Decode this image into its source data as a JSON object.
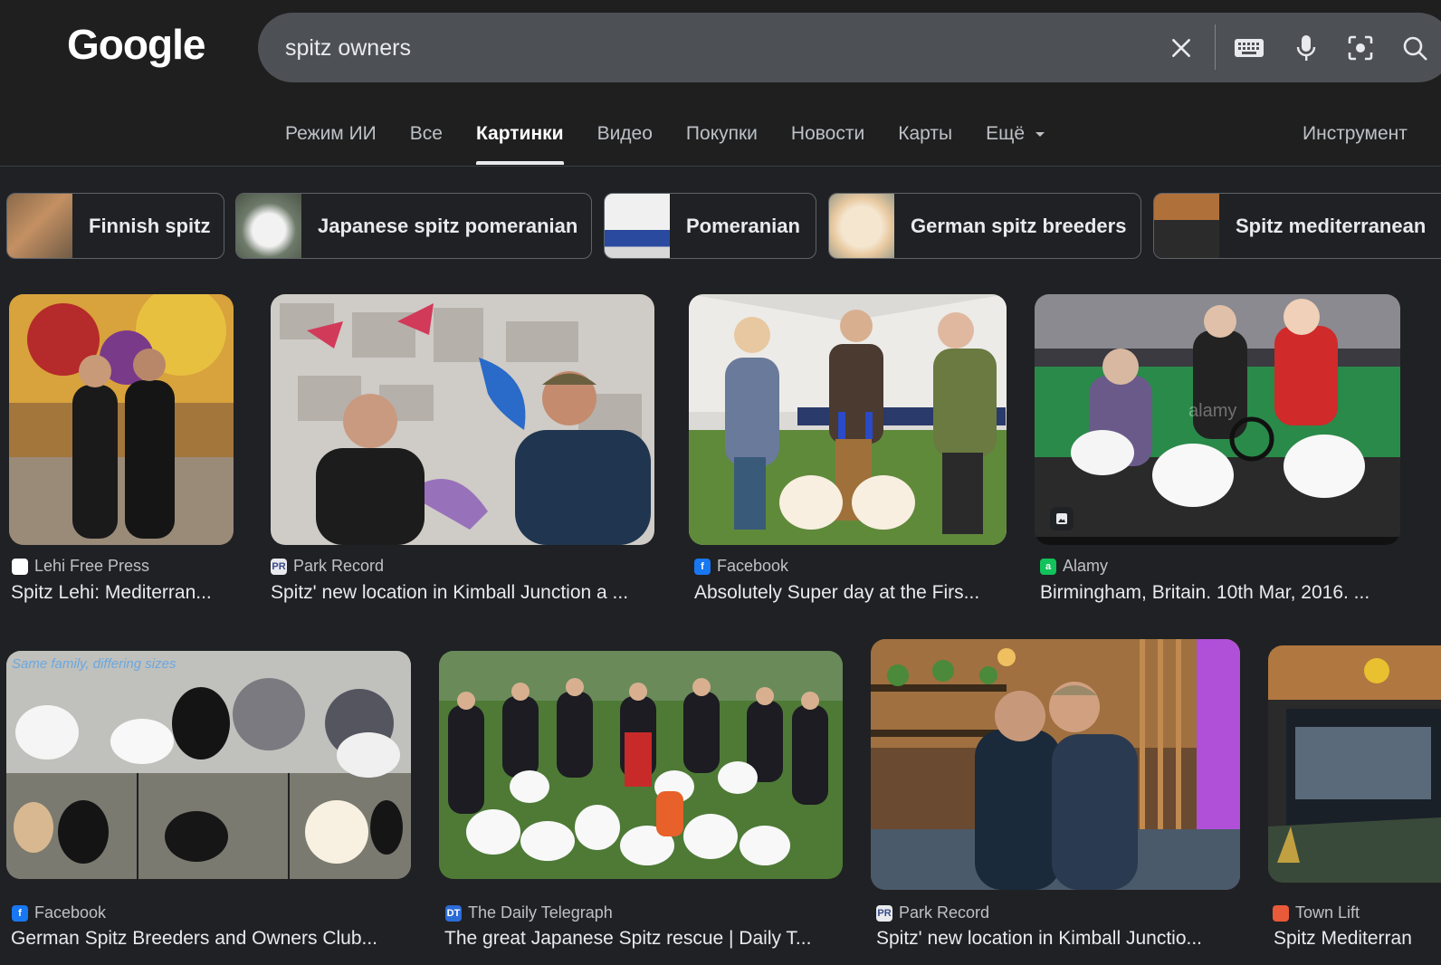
{
  "app": {
    "logo": "Google"
  },
  "search": {
    "query": "spitz owners"
  },
  "tabs": [
    {
      "label": "Режим ИИ"
    },
    {
      "label": "Все"
    },
    {
      "label": "Картинки",
      "active": true
    },
    {
      "label": "Видео"
    },
    {
      "label": "Покупки"
    },
    {
      "label": "Новости"
    },
    {
      "label": "Карты"
    },
    {
      "label": "Ещё"
    }
  ],
  "tools_label": "Инструмент",
  "chips": [
    {
      "label": "Finnish spitz"
    },
    {
      "label": "Japanese spitz pomeranian"
    },
    {
      "label": "Pomeranian"
    },
    {
      "label": "German spitz breeders"
    },
    {
      "label": "Spitz mediterranean"
    }
  ],
  "results": [
    {
      "source": "Lehi Free Press",
      "title": "Spitz Lehi: Mediterran..."
    },
    {
      "source": "Park Record",
      "title": "Spitz' new location in Kimball Junction a ..."
    },
    {
      "source": "Facebook",
      "title": "Absolutely Super day at the Firs..."
    },
    {
      "source": "Alamy",
      "title": "Birmingham, Britain. 10th Mar, 2016. ..."
    },
    {
      "source": "Facebook",
      "title": "German Spitz Breeders and Owners Club..."
    },
    {
      "source": "The Daily Telegraph",
      "title": "The great Japanese Spitz rescue | Daily T..."
    },
    {
      "source": "Park Record",
      "title": "Spitz' new location in Kimball Junctio..."
    },
    {
      "source": "Town Lift",
      "title": "Spitz Mediterran"
    }
  ],
  "image_texts": {
    "overlay_caption": "Same family, differing sizes",
    "alamy_watermark": "alamy",
    "favicon_pr": "PR",
    "favicon_dt": "DT",
    "favicon_alamy": "a",
    "favicon_fb": "f"
  },
  "colors": {
    "background": "#202124",
    "search_bar": "#4d5156",
    "text": "#e8eaed",
    "muted": "#bdc1c6"
  }
}
